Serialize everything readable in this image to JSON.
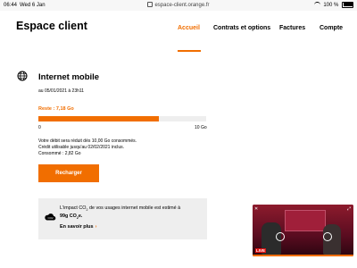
{
  "status_bar": {
    "time": "06:44",
    "date": "Wed 6 Jan",
    "url": "espace-client.orange.fr",
    "battery": "100 %"
  },
  "header": {
    "logo": "Espace client",
    "nav": [
      "Accueil",
      "Contrats et options",
      "Factures",
      "Compte"
    ],
    "active_index": 0
  },
  "usage": {
    "title": "Internet mobile",
    "date_line": "au 05/01/2021 à 23h11",
    "remaining_label": "Reste : 7,18 Go",
    "progress_fraction": 0.72,
    "min_label": "0",
    "max_label": "10 Go",
    "info_lines": [
      "Votre débit sera réduit dès 10,00 Go consommés.",
      "Crédit utilisable jusqu'au 02/02/2021 inclus.",
      "Consommé : 2,82 Go"
    ],
    "button_label": "Recharger"
  },
  "co2": {
    "text_before": "L'impact CO",
    "text_sub": "2",
    "text_after": " de vos usages internet mobile est estimé à",
    "amount": "99g CO",
    "amount_sub": "2",
    "amount_end": "e.",
    "link": "En savoir plus"
  },
  "video": {
    "live_label": "LIVE"
  },
  "colors": {
    "accent": "#f16e00"
  }
}
